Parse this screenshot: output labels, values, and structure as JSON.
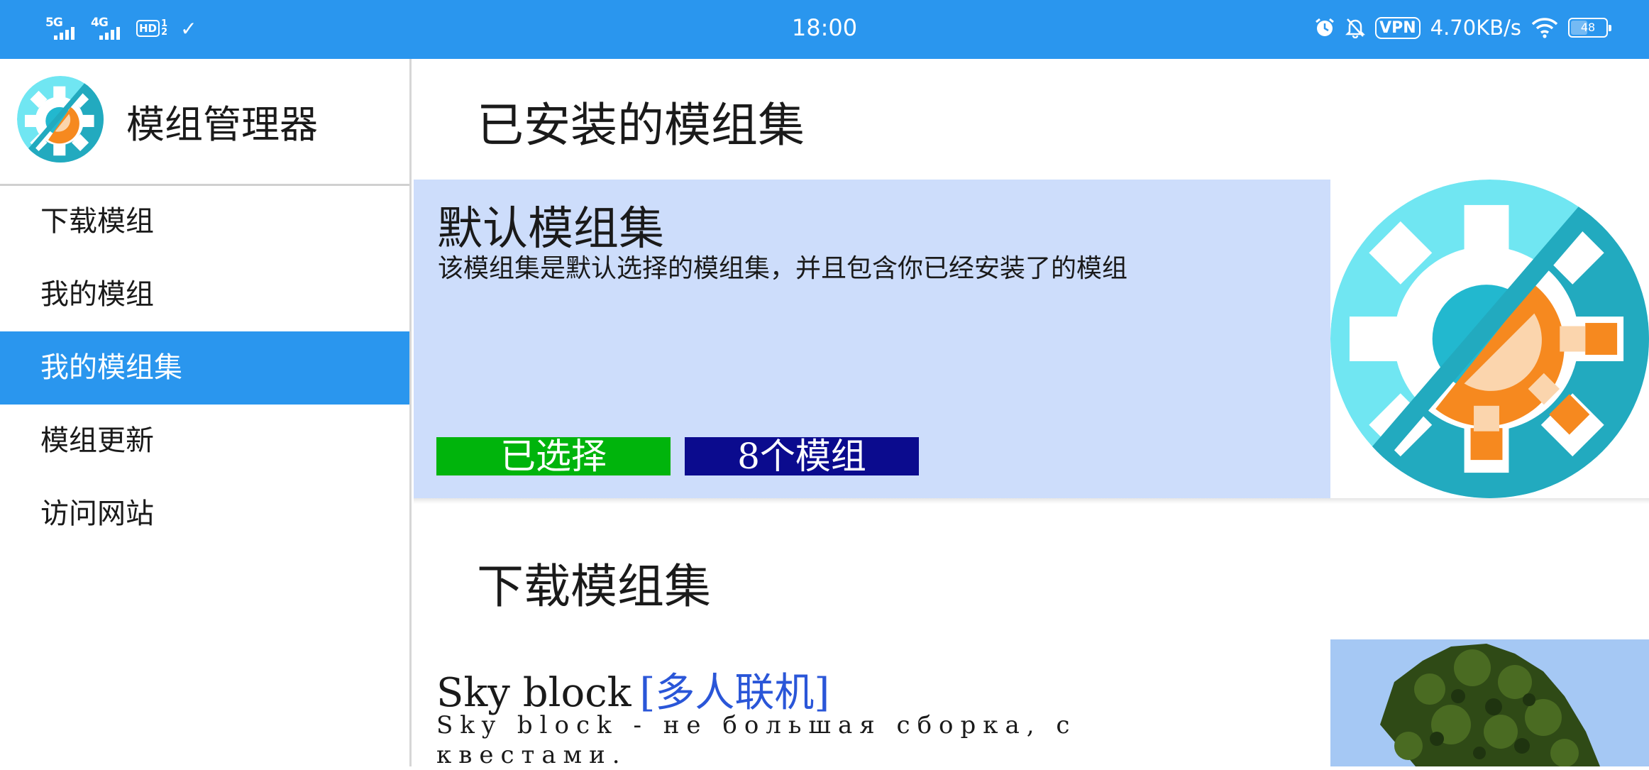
{
  "status_bar": {
    "signal1_label": "5G",
    "signal2_label": "4G",
    "hd_label": "HD",
    "hd_sub": "1\n2",
    "time": "18:00",
    "vpn_label": "VPN",
    "net_speed": "4.70KB/s",
    "battery_level": "48",
    "battery_fraction": 0.48
  },
  "sidebar": {
    "app_title": "模组管理器",
    "items": [
      {
        "label": "下载模组"
      },
      {
        "label": "我的模组"
      },
      {
        "label": "我的模组集",
        "active": true
      },
      {
        "label": "模组更新"
      },
      {
        "label": "访问网站"
      }
    ]
  },
  "main": {
    "installed_heading": "已安装的模组集",
    "default_pack": {
      "title": "默认模组集",
      "description": "该模组集是默认选择的模组集，并且包含你已经安装了的模组",
      "selected_label": "已选择",
      "count_label": "8个模组"
    },
    "download_heading": "下载模组集",
    "download_items": [
      {
        "title": "Sky block",
        "tag": "[多人联机]",
        "description": "Sky block - не большая сборка, с квестами."
      }
    ]
  },
  "colors": {
    "accent": "#2a96ee",
    "card_bg": "#cdddfb",
    "selected_green": "#00b40c",
    "count_navy": "#0b0b8e",
    "tag_blue": "#2a56d8"
  },
  "icons": [
    "signal-icon",
    "hd-voice-icon",
    "check-icon",
    "alarm-icon",
    "mute-icon",
    "wifi-icon",
    "battery-icon",
    "app-logo-icon",
    "pack-gear-icon",
    "tree-image"
  ]
}
